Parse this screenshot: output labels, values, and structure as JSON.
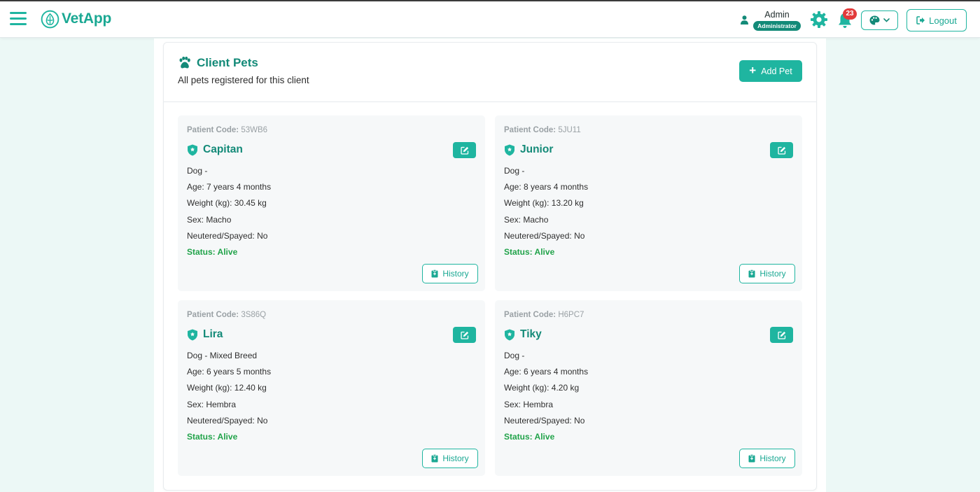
{
  "app": {
    "name": "VetApp"
  },
  "header": {
    "user_name": "Admin",
    "user_role": "Administrator",
    "notification_count": "23",
    "logout_label": "Logout",
    "icons": [
      "menu-icon",
      "vetapp-logo-icon",
      "user-icon",
      "gear-icon",
      "bell-icon",
      "palette-icon",
      "chevron-down-icon",
      "logout-icon"
    ]
  },
  "section": {
    "title": "Client Pets",
    "subtitle": "All pets registered for this client",
    "add_label": "Add Pet"
  },
  "labels": {
    "patient_code": "Patient Code:",
    "history": "History"
  },
  "pets": [
    {
      "code": "53WB6",
      "name": "Capitan",
      "species": "Dog -",
      "age": "Age: 7 years 4 months",
      "weight": "Weight (kg): 30.45 kg",
      "sex": "Sex: Macho",
      "neutered": "Neutered/Spayed: No",
      "status": "Status: Alive"
    },
    {
      "code": "5JU11",
      "name": "Junior",
      "species": "Dog -",
      "age": "Age: 8 years 4 months",
      "weight": "Weight (kg): 13.20 kg",
      "sex": "Sex: Macho",
      "neutered": "Neutered/Spayed: No",
      "status": "Status: Alive"
    },
    {
      "code": "3S86Q",
      "name": "Lira",
      "species": "Dog - Mixed Breed",
      "age": "Age: 6 years 5 months",
      "weight": "Weight (kg): 12.40 kg",
      "sex": "Sex: Hembra",
      "neutered": "Neutered/Spayed: No",
      "status": "Status: Alive"
    },
    {
      "code": "H6PC7",
      "name": "Tiky",
      "species": "Dog -",
      "age": "Age: 6 years 4 months",
      "weight": "Weight (kg): 4.20 kg",
      "sex": "Sex: Hembra",
      "neutered": "Neutered/Spayed: No",
      "status": "Status: Alive"
    }
  ],
  "colors": {
    "accent": "#1fb5a0",
    "accent_dark": "#138a78",
    "status_alive": "#21a34a",
    "badge_red": "#e23b3b",
    "page_bg": "#ecf8f6"
  }
}
